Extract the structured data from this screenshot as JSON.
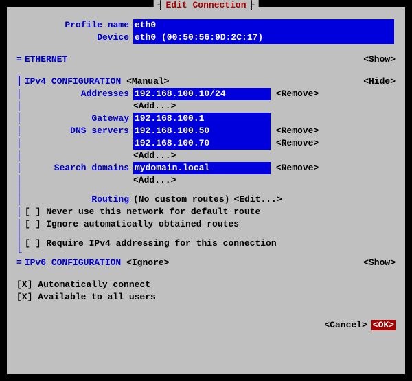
{
  "title": "Edit Connection",
  "profile": {
    "name_label": "Profile name",
    "name_value": "eth0",
    "device_label": "Device",
    "device_value": "eth0 (00:50:56:9D:2C:17)"
  },
  "ethernet": {
    "marker": "=",
    "label": "ETHERNET",
    "toggle": "<Show>"
  },
  "ipv4": {
    "marker": "┃",
    "label": "IPv4 CONFIGURATION",
    "mode": "<Manual>",
    "toggle": "<Hide>",
    "addresses_label": "Addresses",
    "addresses": [
      "192.168.100.10/24"
    ],
    "gateway_label": "Gateway",
    "gateway": "192.168.100.1",
    "dns_label": "DNS servers",
    "dns": [
      "192.168.100.50",
      "192.168.100.70"
    ],
    "search_label": "Search domains",
    "search": [
      "mydomain.local"
    ],
    "add": "<Add...>",
    "remove": "<Remove>",
    "routing_label": "Routing",
    "routing_text": "(No custom routes)",
    "routing_edit": "<Edit...>",
    "check_never_default": "[ ] Never use this network for default route",
    "check_ignore_auto": "[ ] Ignore automatically obtained routes",
    "check_require": "[ ] Require IPv4 addressing for this connection"
  },
  "ipv6": {
    "marker": "=",
    "label": "IPv6 CONFIGURATION",
    "mode": "<Ignore>",
    "toggle": "<Show>"
  },
  "general": {
    "auto_connect": "[X] Automatically connect",
    "all_users": "[X] Available to all users"
  },
  "buttons": {
    "cancel": "<Cancel>",
    "ok": "<OK>"
  }
}
